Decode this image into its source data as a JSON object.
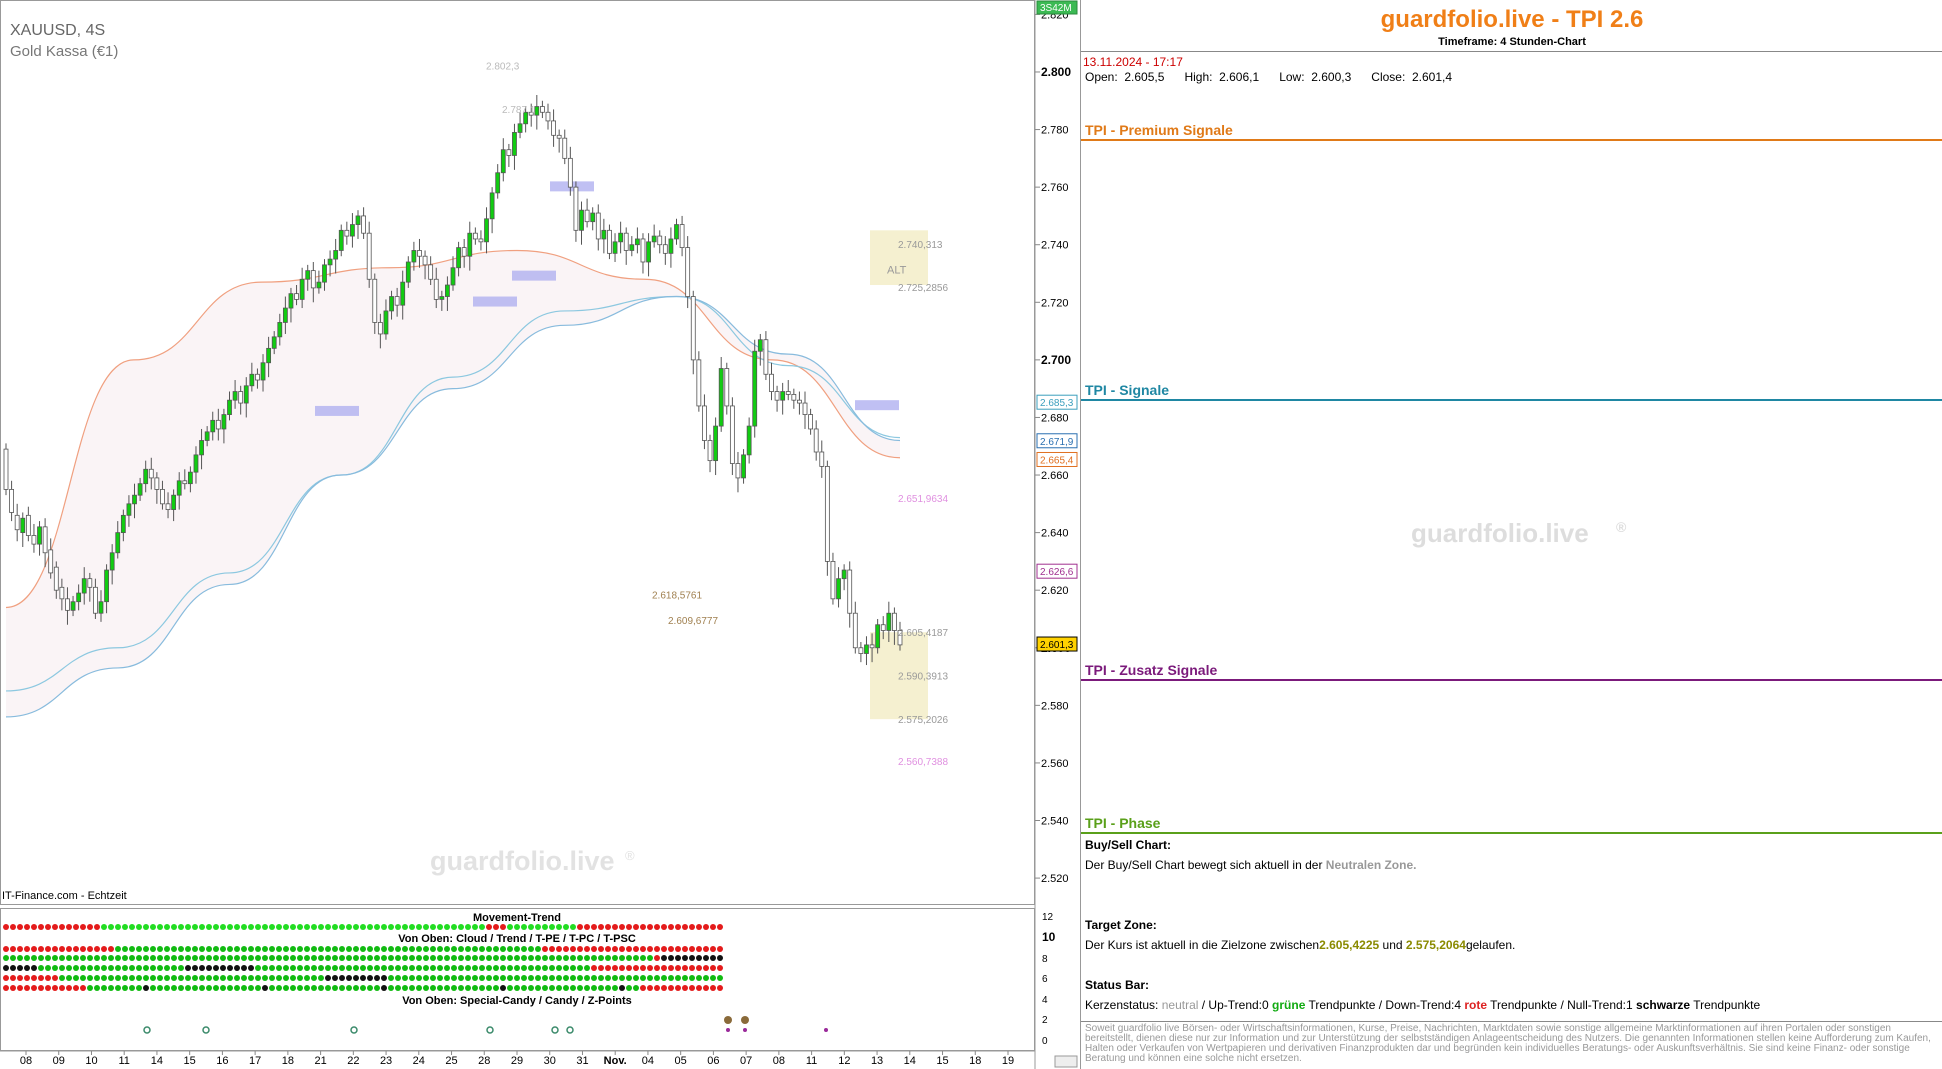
{
  "chart_meta": {
    "symbol": "XAUUSD, 4S",
    "name": "Gold Kassa (€1)",
    "source": "IT-Finance.com - Echtzeit",
    "watermark": "guardfolio.live",
    "top_badge": "3S42M",
    "movement_title": "Movement-Trend",
    "cloud_title": "Von Oben: Cloud / Trend / T-PE / T-PC / T-PSC",
    "special_title": "Von Oben: Special-Candy / Candy / Z-Points",
    "alt_label": "ALT"
  },
  "chart_data": {
    "type": "candlestick",
    "x_tick_labels": [
      "08",
      "09",
      "10",
      "11",
      "14",
      "15",
      "16",
      "17",
      "18",
      "21",
      "22",
      "23",
      "24",
      "25",
      "28",
      "29",
      "30",
      "31",
      "Nov.",
      "04",
      "05",
      "06",
      "07",
      "08",
      "11",
      "12",
      "13",
      "14",
      "15",
      "18",
      "19"
    ],
    "y_ticks": [
      2820,
      2800,
      2780,
      2760,
      2740,
      2720,
      2700,
      2680,
      2660,
      2640,
      2620,
      2600,
      2580,
      2560,
      2540,
      2520
    ],
    "y_tick_labels": [
      "2.820",
      "2.800",
      "2.780",
      "2.760",
      "2.740",
      "2.720",
      "2.700",
      "2.680",
      "2.660",
      "2.640",
      "2.620",
      "2.600",
      "2.580",
      "2.560",
      "2.540",
      "2.520"
    ],
    "ylim": [
      2511,
      2825
    ],
    "closes": [
      2655,
      2647,
      2641,
      2645,
      2639,
      2636,
      2642,
      2633,
      2626,
      2620,
      2617,
      2613,
      2616,
      2619,
      2624,
      2621,
      2612,
      2616,
      2627,
      2633,
      2640,
      2646,
      2650,
      2653,
      2657,
      2662,
      2659,
      2655,
      2650,
      2648,
      2653,
      2658,
      2657,
      2661,
      2667,
      2672,
      2675,
      2679,
      2676,
      2681,
      2686,
      2689,
      2685,
      2691,
      2695,
      2693,
      2699,
      2704,
      2708,
      2713,
      2718,
      2723,
      2721,
      2728,
      2731,
      2725,
      2727,
      2733,
      2735,
      2738,
      2745,
      2743,
      2747,
      2750,
      2744,
      2728,
      2713,
      2709,
      2717,
      2722,
      2719,
      2727,
      2734,
      2738,
      2736,
      2733,
      2728,
      2721,
      2722,
      2726,
      2732,
      2739,
      2736,
      2744,
      2742,
      2741,
      2749,
      2758,
      2765,
      2773,
      2771,
      2779,
      2782,
      2786,
      2785,
      2788,
      2786,
      2783,
      2778,
      2777,
      2770,
      2760,
      2745,
      2752,
      2748,
      2751,
      2742,
      2745,
      2737,
      2741,
      2744,
      2738,
      2740,
      2742,
      2734,
      2741,
      2743,
      2740,
      2737,
      2742,
      2747,
      2739,
      2722,
      2700,
      2684,
      2672,
      2665,
      2677,
      2697,
      2684,
      2664,
      2659,
      2667,
      2677,
      2703,
      2707,
      2695,
      2689,
      2686,
      2689,
      2688,
      2686,
      2685,
      2681,
      2676,
      2668,
      2663,
      2630,
      2617,
      2624,
      2627,
      2612,
      2600,
      2598,
      2601,
      2600,
      2608,
      2606,
      2612,
      2606,
      2601
    ],
    "opens": [
      2669,
      2655,
      2646,
      2640,
      2646,
      2639,
      2636,
      2642,
      2634,
      2628,
      2621,
      2617,
      2613,
      2616,
      2619,
      2624,
      2621,
      2612,
      2616,
      2627,
      2633,
      2640,
      2646,
      2650,
      2653,
      2657,
      2662,
      2659,
      2655,
      2650,
      2648,
      2653,
      2658,
      2657,
      2661,
      2667,
      2672,
      2675,
      2679,
      2676,
      2681,
      2686,
      2689,
      2685,
      2691,
      2695,
      2693,
      2699,
      2704,
      2708,
      2713,
      2718,
      2723,
      2721,
      2728,
      2731,
      2725,
      2727,
      2733,
      2735,
      2738,
      2745,
      2743,
      2747,
      2750,
      2744,
      2728,
      2713,
      2709,
      2717,
      2722,
      2719,
      2727,
      2734,
      2738,
      2736,
      2733,
      2728,
      2721,
      2722,
      2726,
      2732,
      2739,
      2736,
      2744,
      2742,
      2741,
      2749,
      2758,
      2765,
      2773,
      2771,
      2779,
      2782,
      2786,
      2785,
      2788,
      2786,
      2783,
      2778,
      2777,
      2770,
      2760,
      2745,
      2752,
      2748,
      2751,
      2742,
      2745,
      2737,
      2741,
      2744,
      2738,
      2740,
      2742,
      2734,
      2741,
      2743,
      2740,
      2737,
      2742,
      2747,
      2739,
      2722,
      2700,
      2684,
      2672,
      2665,
      2677,
      2697,
      2684,
      2664,
      2659,
      2667,
      2677,
      2703,
      2707,
      2695,
      2689,
      2686,
      2689,
      2688,
      2686,
      2685,
      2681,
      2676,
      2668,
      2663,
      2630,
      2617,
      2624,
      2627,
      2612,
      2600,
      2598,
      2601,
      2600,
      2608,
      2606,
      2612,
      2606
    ],
    "ma_series": [
      {
        "name": "orange",
        "color": "#f0a080",
        "values": [
          2614,
          2700,
          2727,
          2732,
          2738,
          2728,
          2700,
          2666
        ]
      },
      {
        "name": "cyan",
        "color": "#8cc8e0",
        "values": [
          2585,
          2600,
          2626,
          2660,
          2694,
          2717,
          2722,
          2698,
          2673
        ]
      },
      {
        "name": "blue",
        "color": "#88bbdd",
        "values": [
          2576,
          2593,
          2622,
          2660,
          2690,
          2712,
          2722,
          2702,
          2672
        ]
      }
    ],
    "annotations_left": [
      {
        "text": "2.802,3",
        "y": 2802.3
      },
      {
        "text": "2.787,1",
        "y": 2787.1
      },
      {
        "text": "2.618,5761",
        "y": 2618.58
      },
      {
        "text": "2.609,6777",
        "y": 2609.68
      }
    ],
    "annotations_right": [
      {
        "text": "2.740,313",
        "y": 2740.31,
        "color": "#999"
      },
      {
        "text": "2.725,2856",
        "y": 2725.29,
        "color": "#999"
      },
      {
        "text": "2.651,9634",
        "y": 2651.96,
        "color": "#e090e0"
      },
      {
        "text": "2.605,4187",
        "y": 2605.42,
        "color": "#999"
      },
      {
        "text": "2.590,3913",
        "y": 2590.39,
        "color": "#999"
      },
      {
        "text": "2.575,2026",
        "y": 2575.2,
        "color": "#999"
      },
      {
        "text": "2.560,7388",
        "y": 2560.74,
        "color": "#e090e0"
      }
    ],
    "axis_markers": [
      {
        "text": "2.685,3",
        "y": 2685.3,
        "color": "#3b9fbd"
      },
      {
        "text": "2.671,9",
        "y": 2671.9,
        "color": "#2a6fb0"
      },
      {
        "text": "2.665,4",
        "y": 2665.4,
        "color": "#e07020"
      },
      {
        "text": "2.626,6",
        "y": 2626.6,
        "color": "#a03090"
      },
      {
        "text": "2.601,3",
        "y": 2601.3,
        "color": "#000",
        "bg": "#ffd200"
      }
    ],
    "indicator_axis": [
      "12",
      "10",
      "8",
      "6",
      "4",
      "2",
      "0"
    ]
  },
  "panel": {
    "title": "guardfolio.live - TPI 2.6",
    "timeframe": "Timeframe: 4 Stunden-Chart",
    "datetime": "13.11.2024 - 17:17",
    "open_label": "Open:",
    "open": "2.605,5",
    "high_label": "High:",
    "high": "2.606,1",
    "low_label": "Low:",
    "low": "2.600,3",
    "close_label": "Close:",
    "close": "2.601,4",
    "sec_premium": "TPI - Premium Signale",
    "sec_signale": "TPI - Signale",
    "sec_zusatz": "TPI - Zusatz Signale",
    "sec_phase": "TPI - Phase",
    "watermark": "guardfolio.live",
    "buysell_label": "Buy/Sell Chart:",
    "buysell_text": "Der Buy/Sell Chart bewegt sich aktuell in der",
    "buysell_zone": "Neutralen Zone.",
    "target_label": "Target Zone:",
    "target_text": "Der Kurs ist aktuell in die Zielzone zwischen",
    "target_a": "2.605,4225",
    "target_und": "und",
    "target_b": "2.575,2064",
    "target_end": "gelaufen.",
    "status_label": "Status Bar:",
    "status_a": "Kerzenstatus:",
    "status_neutral": "neutral",
    "status_b": "/ Up-Trend:0",
    "status_gruene": "grüne",
    "status_c": "Trendpunkte  / Down-Trend:4",
    "status_rote": "rote",
    "status_d": "Trendpunkte / Null-Trend:1",
    "status_schwarze": "schwarze",
    "status_e": "Trendpunkte",
    "disclaimer": "Soweit guardfolio live Börsen- oder Wirtschaftsinformationen, Kurse, Preise, Nachrichten, Marktdaten sowie sonstige allgemeine Marktinformationen auf ihren Portalen oder sonstigen bereitstellt, dienen diese nur zur Information und zur Unterstützung der selbstständigen Anlageentscheidung des Nutzers. Die genannten Informationen stellen keine Aufforderung zum Kaufen, Halten oder Verkaufen von Wertpapieren und derivativen Finanzprodukten dar und begründen kein individuelles Beratungs- oder Auskunftsverhältnis. Sie sind keine Finanz- oder sonstige Beratung und können eine solche nicht ersetzen."
  },
  "colors": {
    "brand": "#f07f17",
    "premium": "#e07a18",
    "signale": "#1f87a3",
    "zusatz": "#7b1a7b",
    "phase": "#5aa01a",
    "up": "#11cc11",
    "down": "#ffffff"
  }
}
